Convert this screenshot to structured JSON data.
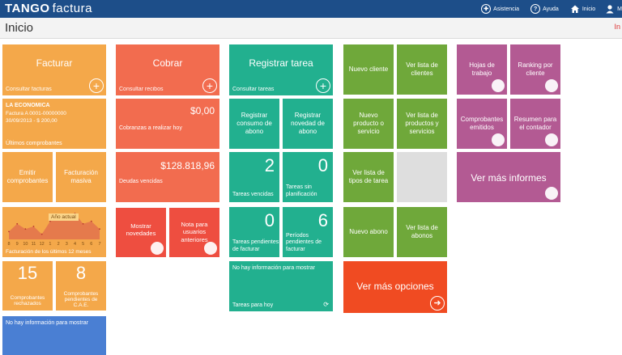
{
  "app": {
    "brand": "TANGO",
    "brand_suffix": "factura"
  },
  "topnav": {
    "asistencia": "Asistencia",
    "ayuda": "Ayuda",
    "inicio": "Inicio",
    "user_initial": "M"
  },
  "page": {
    "title": "Inicio",
    "right_text": "In"
  },
  "col1": {
    "facturar": {
      "title": "Facturar",
      "sub": "Consultar facturas"
    },
    "empresa": {
      "name": "LA ECONOMICA",
      "line1": "Factura A 0001-00000000",
      "line2": "30/09/2013 - $ 200,00",
      "line3": "Últimos comprobantes"
    },
    "emitir": "Emitir comprobantes",
    "facturacion_masiva": "Facturación masiva",
    "chart": {
      "label": "Año actual",
      "months": [
        "8",
        "9",
        "10",
        "11",
        "12",
        "1",
        "2",
        "3",
        "4",
        "5",
        "6",
        "7"
      ],
      "caption": "Facturación de los últimos 12 meses"
    },
    "comprobantes_rechazados": {
      "value": "15",
      "label": "Comprobantes rechazados"
    },
    "pendientes_cae": {
      "value": "8",
      "label": "Comprobantes pendientes de C.A.E."
    },
    "no_info": "No hay información para mostrar"
  },
  "col2": {
    "cobrar": {
      "title": "Cobrar",
      "sub": "Consultar recibos"
    },
    "cobranzas": {
      "value": "$0,00",
      "label": "Cobranzas a realizar hoy"
    },
    "deudas": {
      "value": "$128.818,96",
      "label": "Deudas vencidas"
    },
    "mostrar_novedades": "Mostrar novedades",
    "nota_anteriores": "Nota para usuarios anteriores"
  },
  "col3": {
    "registrar": {
      "title": "Registrar tarea",
      "sub": "Consultar tareas"
    },
    "reg_consumo": "Registrar consumo de abono",
    "reg_novedad": "Registrar novedad de abono",
    "tareas_vencidas": {
      "value": "2",
      "label": "Tareas vencidas"
    },
    "tareas_sin_plan": {
      "value": "0",
      "label": "Tareas sin planificación"
    },
    "tareas_pend_fact": {
      "value": "0",
      "label": "Tareas pendientes de facturar"
    },
    "periodos_pend": {
      "value": "6",
      "label": "Períodos pendientes de facturar"
    },
    "tareas_hoy": {
      "info": "No hay información para mostrar",
      "label": "Tareas para hoy"
    }
  },
  "col4": {
    "nuevo_cliente": "Nuevo cliente",
    "ver_clientes": "Ver lista de clientes",
    "nuevo_producto": "Nuevo producto o servicio",
    "ver_productos": "Ver lista de productos y servicios",
    "ver_tipos_tarea": "Ver lista de tipos de tarea",
    "nuevo_abono": "Nuevo abono",
    "ver_abonos": "Ver lista de abonos",
    "ver_mas_opciones": "Ver más opciones"
  },
  "col5": {
    "hojas_trabajo": "Hojas de trabajo",
    "ranking_cliente": "Ranking por cliente",
    "comprobantes_emitidos": "Comprobantes emitidos",
    "resumen_contador": "Resumen para el contador",
    "ver_mas_informes": "Ver más informes"
  },
  "chart_data": {
    "type": "area",
    "title": "Año actual",
    "xlabel": "Facturación de los últimos 12 meses",
    "ylabel": "",
    "categories": [
      "8",
      "9",
      "10",
      "11",
      "12",
      "1",
      "2",
      "3",
      "4",
      "5",
      "6",
      "7"
    ],
    "values": [
      3,
      6,
      4,
      5,
      2,
      7,
      9,
      8,
      10,
      6,
      7,
      4
    ],
    "grid": false
  },
  "colors": {
    "topbar": "#1d4e89",
    "orange": "#f4a84a",
    "salmon": "#f26c4f",
    "teal": "#22b08f",
    "green": "#6fa83a",
    "purple": "#b35a93"
  }
}
